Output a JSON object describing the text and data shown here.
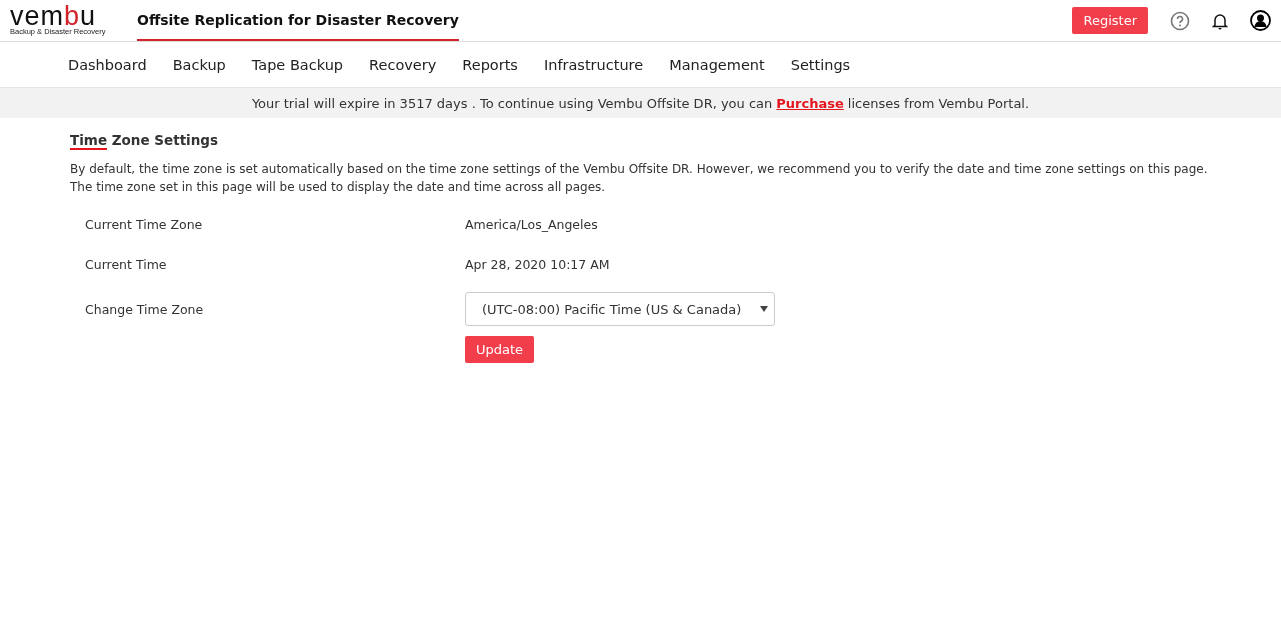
{
  "header": {
    "logo": {
      "before": "vem",
      "accent": "b",
      "after": "u",
      "tagline": "Backup & Disaster Recovery"
    },
    "product_tab": {
      "label": "Offsite Replication for Disaster Recovery",
      "selected": true
    },
    "register_button": "Register"
  },
  "nav": [
    "Dashboard",
    "Backup",
    "Tape Backup",
    "Recovery",
    "Reports",
    "Infrastructure",
    "Management",
    "Settings"
  ],
  "banner": {
    "before": "Your trial will expire in 3517 days . To continue using Vembu Offsite DR, you can",
    "link": "Purchase",
    "after": "licenses from Vembu Portal."
  },
  "section": {
    "title_underlined": "Time",
    "title_rest": "Zone Settings",
    "description": "By default, the time zone is set automatically based on the time zone settings of the Vembu Offsite DR. However, we recommend you to verify the date and time zone settings on this page. The time zone set in this page will be used to display the date and time across all pages.",
    "rows": [
      {
        "kind": "text",
        "label": "Current Time Zone",
        "value": "America/Los_Angeles"
      },
      {
        "kind": "text",
        "label": "Current Time",
        "value": "Apr 28, 2020 10:17 AM"
      },
      {
        "kind": "select",
        "label": "Change Time Zone",
        "value": "(UTC-08:00) Pacific Time (US & Canada)"
      }
    ],
    "update_button": "Update"
  }
}
